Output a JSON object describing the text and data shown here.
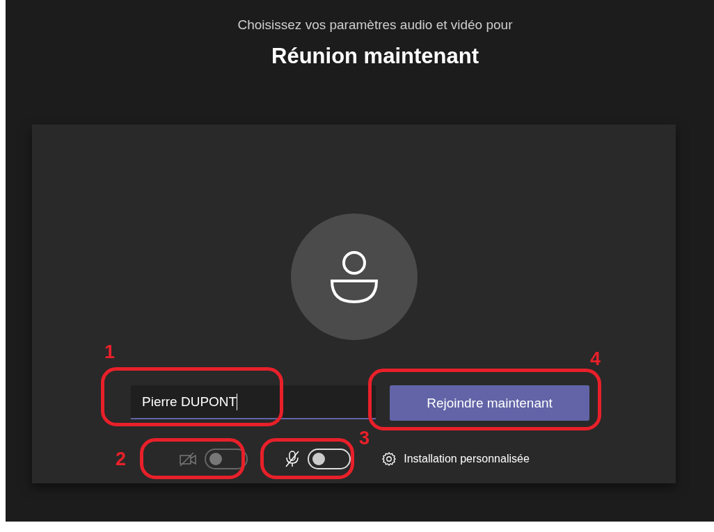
{
  "header": {
    "subtitle": "Choisissez vos paramètres audio et vidéo pour",
    "title": "Réunion maintenant"
  },
  "name_field": {
    "value": "Pierre DUPONT"
  },
  "join_button": {
    "label": "Rejoindre maintenant"
  },
  "camera_toggle": {
    "on": false,
    "disabled": true
  },
  "mic_toggle": {
    "on": false,
    "disabled": false
  },
  "settings_link": {
    "label": "Installation personnalisée"
  },
  "annotations": [
    {
      "label": "1"
    },
    {
      "label": "2"
    },
    {
      "label": "3"
    },
    {
      "label": "4"
    }
  ]
}
